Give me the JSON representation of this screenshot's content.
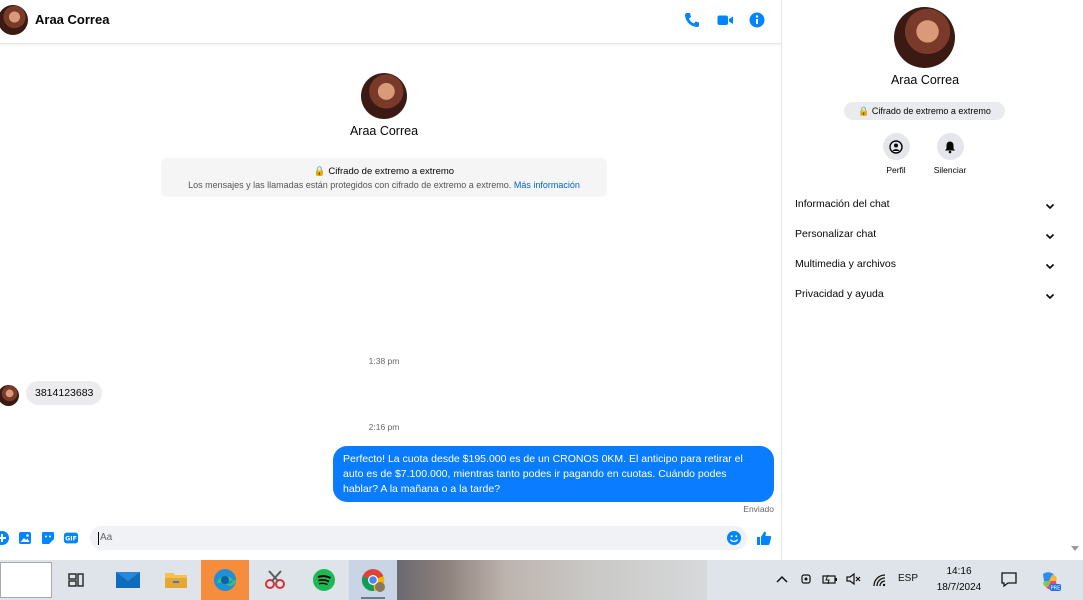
{
  "contact": {
    "name": "Araa Correa"
  },
  "intro": {
    "name": "Araa Correa",
    "e2e_title": "Cifrado de extremo a extremo",
    "e2e_desc": "Los mensajes y las llamadas están protegidos con cifrado de extremo a extremo.",
    "e2e_link": "Más información"
  },
  "messages": {
    "time1": "1:38 pm",
    "incoming": "3814123683",
    "time2": "2:16 pm",
    "outgoing": "Perfecto! La cuota desde $195.000 es de un CRONOS 0KM. El anticipo para retirar el auto es de $7.100.000, mientras tanto podes ir pagando en cuotas. Cuándo podes hablar? A la mañana o a la tarde?",
    "status": "Enviado"
  },
  "composer": {
    "placeholder": "Aa"
  },
  "info_panel": {
    "name": "Araa Correa",
    "e2e_badge": "Cifrado de extremo a extremo",
    "actions": [
      "Perfil",
      "Silenciar"
    ],
    "sections": [
      "Información del chat",
      "Personalizar chat",
      "Multimedia y archivos",
      "Privacidad y ayuda"
    ]
  },
  "taskbar": {
    "language": "ESP",
    "time": "14:16",
    "date": "18/7/2024",
    "apps": [
      "task-view",
      "mail",
      "file-explorer",
      "edge",
      "snipping-tool",
      "spotify",
      "chrome"
    ]
  },
  "colors": {
    "accent": "#0a7cff",
    "icon_blue": "#0084ff",
    "taskbar_active": "#f58d3d"
  }
}
